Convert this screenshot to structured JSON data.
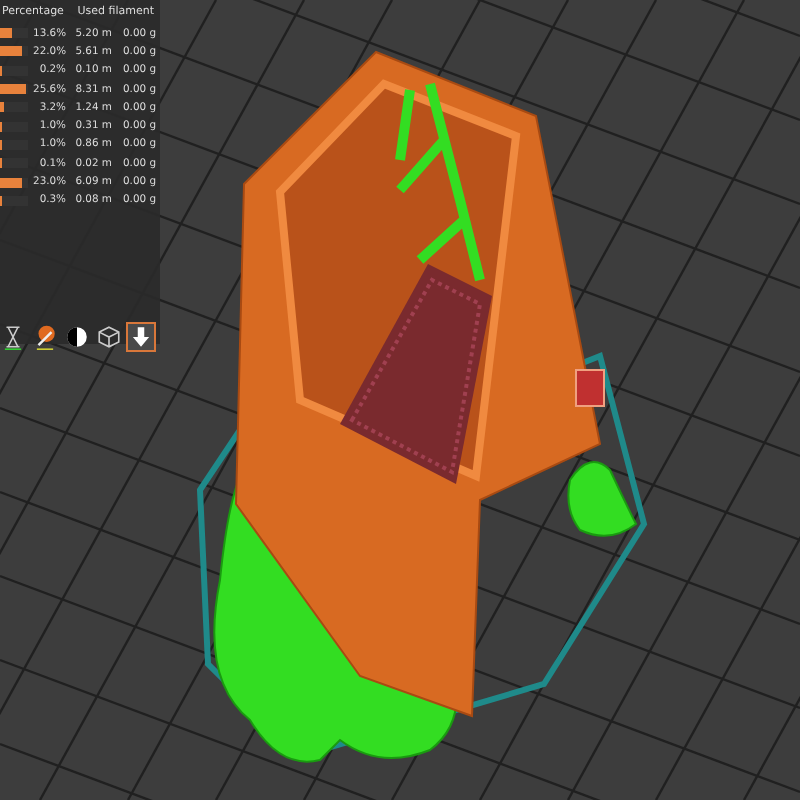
{
  "legend": {
    "columns": [
      "Percentage",
      "Used filament"
    ],
    "rows": [
      {
        "level": 0.45,
        "percentage": "13.6%",
        "length": "5.20 m",
        "weight": "0.00 g"
      },
      {
        "level": 0.75,
        "percentage": "22.0%",
        "length": "5.61 m",
        "weight": "0.00 g"
      },
      {
        "level": 0.06,
        "percentage": "0.2%",
        "length": "0.10 m",
        "weight": "0.00 g"
      },
      {
        "level": 0.9,
        "percentage": "25.6%",
        "length": "8.31 m",
        "weight": "0.00 g"
      },
      {
        "level": 0.12,
        "percentage": "3.2%",
        "length": "1.24 m",
        "weight": "0.00 g"
      },
      {
        "level": 0.06,
        "percentage": "1.0%",
        "length": "0.31 m",
        "weight": "0.00 g"
      },
      {
        "level": 0.06,
        "percentage": "1.0%",
        "length": "0.86 m",
        "weight": "0.00 g"
      },
      {
        "level": 0.04,
        "percentage": "0.1%",
        "length": "0.02 m",
        "weight": "0.00 g"
      },
      {
        "level": 0.8,
        "percentage": "23.0%",
        "length": "6.09 m",
        "weight": "0.00 g"
      },
      {
        "level": 0.04,
        "percentage": "0.3%",
        "length": "0.08 m",
        "weight": "0.00 g"
      }
    ]
  },
  "toolbar": [
    {
      "kind": "hourglass",
      "selected": false
    },
    {
      "kind": "brush",
      "selected": false
    },
    {
      "kind": "contrast",
      "selected": false
    },
    {
      "kind": "cube",
      "selected": false
    },
    {
      "kind": "export",
      "selected": true
    }
  ]
}
